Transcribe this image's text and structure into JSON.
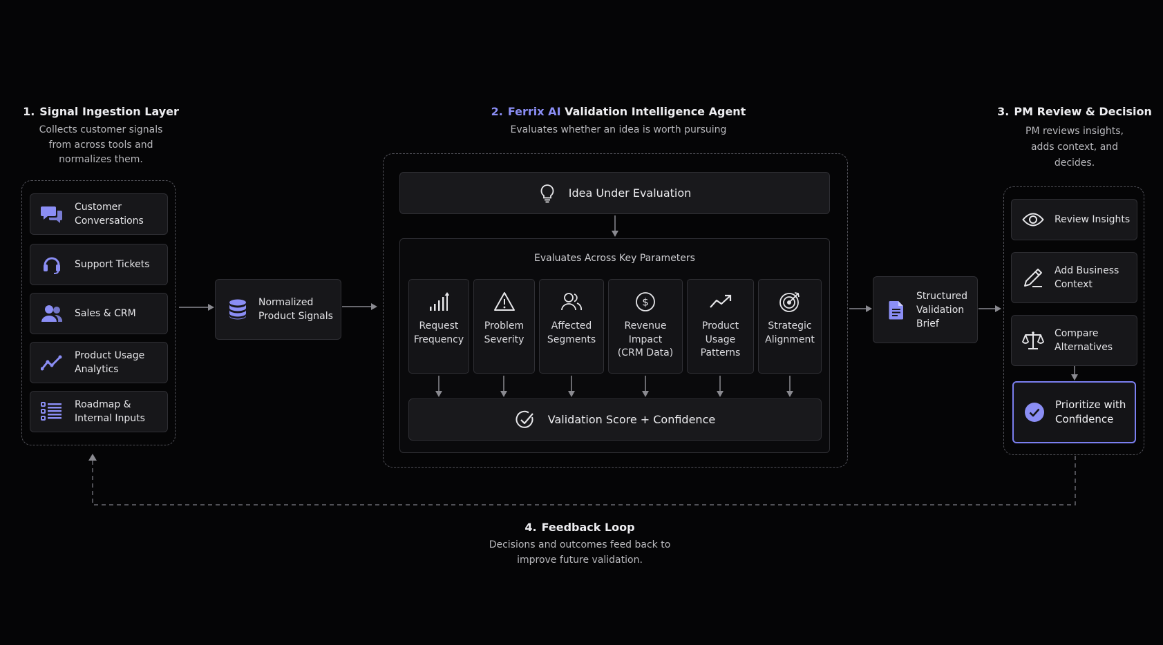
{
  "signal_layer": {
    "number": "1.",
    "title": "Signal Ingestion Layer",
    "description_lines": [
      "Collects customer signals",
      "from across tools and",
      "normalizes them."
    ],
    "sources": [
      {
        "label_lines": [
          "Customer",
          "Conversations"
        ],
        "icon": "chat-bubbles-icon"
      },
      {
        "label_lines": [
          "Support Tickets"
        ],
        "icon": "headset-icon"
      },
      {
        "label_lines": [
          "Sales & CRM"
        ],
        "icon": "users-icon"
      },
      {
        "label_lines": [
          "Product Usage",
          "Analytics"
        ],
        "icon": "trend-line-icon"
      },
      {
        "label_lines": [
          "Roadmap &",
          "Internal Inputs"
        ],
        "icon": "checklist-icon"
      }
    ]
  },
  "normalized": {
    "label_lines": [
      "Normalized",
      "Product Signals"
    ],
    "icon": "database-icon"
  },
  "agent": {
    "number": "2.",
    "brand": "Ferrix AI",
    "title": "Validation Intelligence Agent",
    "description": "Evaluates whether an idea is worth pursuing",
    "idea_label": "Idea Under Evaluation",
    "idea_icon": "lightbulb-icon",
    "params_title": "Evaluates Across Key Parameters",
    "parameters": [
      {
        "label_lines": [
          "Request",
          "Frequency"
        ],
        "icon": "bar-chart-up-icon"
      },
      {
        "label_lines": [
          "Problem",
          "Severity"
        ],
        "icon": "warning-triangle-icon"
      },
      {
        "label_lines": [
          "Affected",
          "Segments"
        ],
        "icon": "users-outline-icon"
      },
      {
        "label_lines": [
          "Revenue",
          "Impact",
          "(CRM Data)"
        ],
        "icon": "dollar-circle-icon"
      },
      {
        "label_lines": [
          "Product",
          "Usage",
          "Patterns"
        ],
        "icon": "trend-arrow-icon"
      },
      {
        "label_lines": [
          "Strategic",
          "Alignment"
        ],
        "icon": "target-icon"
      }
    ],
    "score_label": "Validation Score + Confidence",
    "score_icon": "check-circle-icon"
  },
  "brief": {
    "label_lines": [
      "Structured",
      "Validation",
      "Brief"
    ],
    "icon": "document-icon"
  },
  "pm_review": {
    "number": "3.",
    "title": "PM Review & Decision",
    "description_lines": [
      "PM reviews insights,",
      "adds context, and",
      "decides."
    ],
    "steps": [
      {
        "label_lines": [
          "Review Insights"
        ],
        "icon": "eye-icon"
      },
      {
        "label_lines": [
          "Add Business",
          "Context"
        ],
        "icon": "pencil-icon"
      },
      {
        "label_lines": [
          "Compare",
          "Alternatives"
        ],
        "icon": "scale-icon"
      }
    ],
    "final": {
      "label_lines": [
        "Prioritize with",
        "Confidence"
      ],
      "icon": "check-badge-icon"
    }
  },
  "feedback": {
    "number": "4.",
    "title": "Feedback Loop",
    "description_lines": [
      "Decisions and outcomes feed back to",
      "improve future validation."
    ]
  },
  "colors": {
    "background": "#050506",
    "accent": "#8b8ef5",
    "card": "#17171a",
    "border": "#2f2f34",
    "dash": "#55555c",
    "arrow": "#8a8a90",
    "final_border": "#7b7ff0"
  }
}
